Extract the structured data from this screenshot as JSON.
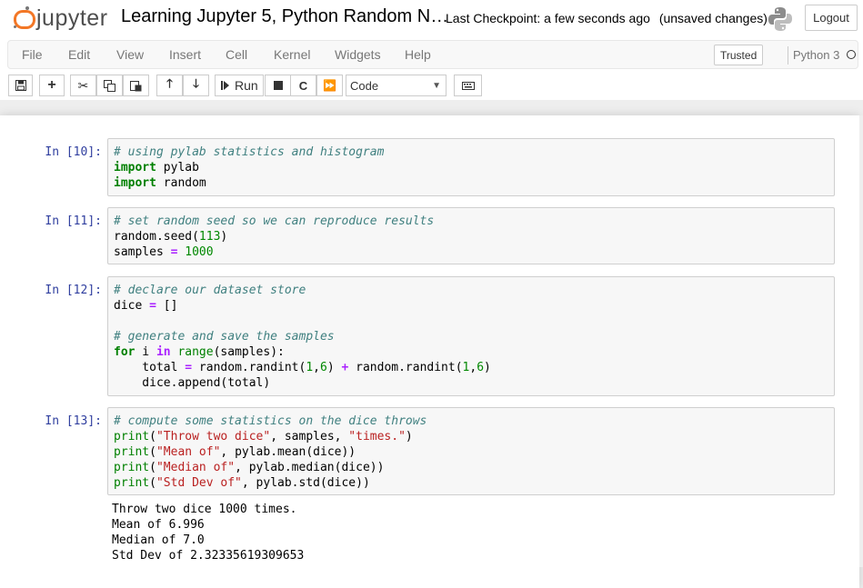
{
  "header": {
    "logo_text": "jupyter",
    "notebook_title": "Learning Jupyter 5, Python Random N…",
    "checkpoint": "Last Checkpoint: a few seconds ago",
    "unsaved": "(unsaved changes)",
    "logout_label": "Logout"
  },
  "menu": {
    "items": [
      "File",
      "Edit",
      "View",
      "Insert",
      "Cell",
      "Kernel",
      "Widgets",
      "Help"
    ],
    "trusted_label": "Trusted",
    "kernel_name": "Python 3"
  },
  "toolbar": {
    "run_label": "Run",
    "cell_type": "Code"
  },
  "cells": [
    {
      "prompt": "In [10]:",
      "lines": [
        [
          {
            "t": "# using pylab statistics and histogram",
            "c": "comment"
          }
        ],
        [
          {
            "t": "import",
            "c": "kw"
          },
          {
            "t": " pylab",
            "c": ""
          }
        ],
        [
          {
            "t": "import",
            "c": "kw"
          },
          {
            "t": " random",
            "c": ""
          }
        ]
      ]
    },
    {
      "prompt": "In [11]:",
      "lines": [
        [
          {
            "t": "# set random seed so we can reproduce results",
            "c": "comment"
          }
        ],
        [
          {
            "t": "random.seed(",
            "c": ""
          },
          {
            "t": "113",
            "c": "num"
          },
          {
            "t": ")",
            "c": ""
          }
        ],
        [
          {
            "t": "samples ",
            "c": ""
          },
          {
            "t": "=",
            "c": "op"
          },
          {
            "t": " ",
            "c": ""
          },
          {
            "t": "1000",
            "c": "num"
          }
        ]
      ]
    },
    {
      "prompt": "In [12]:",
      "lines": [
        [
          {
            "t": "# declare our dataset store",
            "c": "comment"
          }
        ],
        [
          {
            "t": "dice ",
            "c": ""
          },
          {
            "t": "=",
            "c": "op"
          },
          {
            "t": " []",
            "c": ""
          }
        ],
        [
          {
            "t": "",
            "c": ""
          }
        ],
        [
          {
            "t": "# generate and save the samples",
            "c": "comment"
          }
        ],
        [
          {
            "t": "for",
            "c": "kw"
          },
          {
            "t": " i ",
            "c": ""
          },
          {
            "t": "in",
            "c": "op"
          },
          {
            "t": " ",
            "c": ""
          },
          {
            "t": "range",
            "c": "bi"
          },
          {
            "t": "(samples):",
            "c": ""
          }
        ],
        [
          {
            "t": "    total ",
            "c": ""
          },
          {
            "t": "=",
            "c": "op"
          },
          {
            "t": " random.randint(",
            "c": ""
          },
          {
            "t": "1",
            "c": "num"
          },
          {
            "t": ",",
            "c": ""
          },
          {
            "t": "6",
            "c": "num"
          },
          {
            "t": ") ",
            "c": ""
          },
          {
            "t": "+",
            "c": "op"
          },
          {
            "t": " random.randint(",
            "c": ""
          },
          {
            "t": "1",
            "c": "num"
          },
          {
            "t": ",",
            "c": ""
          },
          {
            "t": "6",
            "c": "num"
          },
          {
            "t": ")",
            "c": ""
          }
        ],
        [
          {
            "t": "    dice.append(total)",
            "c": ""
          }
        ]
      ]
    },
    {
      "prompt": "In [13]:",
      "lines": [
        [
          {
            "t": "# compute some statistics on the dice throws",
            "c": "comment"
          }
        ],
        [
          {
            "t": "print",
            "c": "bi"
          },
          {
            "t": "(",
            "c": ""
          },
          {
            "t": "\"Throw two dice\"",
            "c": "str"
          },
          {
            "t": ", samples, ",
            "c": ""
          },
          {
            "t": "\"times.\"",
            "c": "str"
          },
          {
            "t": ")",
            "c": ""
          }
        ],
        [
          {
            "t": "print",
            "c": "bi"
          },
          {
            "t": "(",
            "c": ""
          },
          {
            "t": "\"Mean of\"",
            "c": "str"
          },
          {
            "t": ", pylab.mean(dice))",
            "c": ""
          }
        ],
        [
          {
            "t": "print",
            "c": "bi"
          },
          {
            "t": "(",
            "c": ""
          },
          {
            "t": "\"Median of\"",
            "c": "str"
          },
          {
            "t": ", pylab.median(dice))",
            "c": ""
          }
        ],
        [
          {
            "t": "print",
            "c": "bi"
          },
          {
            "t": "(",
            "c": ""
          },
          {
            "t": "\"Std Dev of\"",
            "c": "str"
          },
          {
            "t": ", pylab.std(dice))",
            "c": ""
          }
        ]
      ],
      "output": [
        "Throw two dice 1000 times.",
        "Mean of 6.996",
        "Median of 7.0",
        "Std Dev of 2.32335619309653"
      ]
    }
  ]
}
